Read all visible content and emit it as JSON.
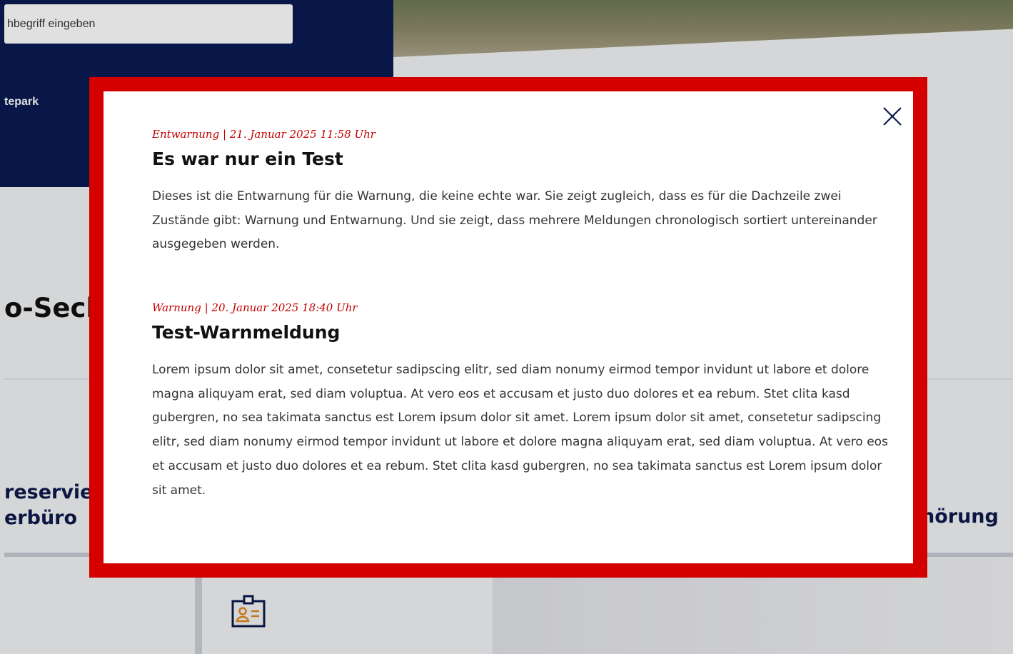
{
  "background": {
    "search": {
      "placeholder": "hbegriff eingeben"
    },
    "nav_link": "tepark",
    "section_heading": "o-Sech",
    "tile_left_line1": "reservie",
    "tile_left_line2": "erbüro",
    "tile_right": "hörung",
    "badge_icon": "id-badge-icon"
  },
  "modal": {
    "close_icon": "close-icon",
    "accent_color": "#d40000",
    "alerts": [
      {
        "meta": "Entwarnung | 21. Januar 2025 11:58 Uhr",
        "title": "Es war nur ein Test",
        "body": "Dieses ist die Entwarnung für die Warnung, die keine echte war. Sie zeigt zugleich, dass es für die Dachzeile zwei Zustände gibt: Warnung und Entwarnung. Und sie zeigt, dass mehrere Meldungen chronologisch sortiert untereinander ausgegeben werden."
      },
      {
        "meta": "Warnung | 20. Januar 2025 18:40 Uhr",
        "title": "Test-Warnmeldung",
        "body": "Lorem ipsum dolor sit amet, consetetur sadipscing elitr, sed diam nonumy eirmod tempor invidunt ut labore et dolore magna aliquyam erat, sed diam voluptua. At vero eos et accusam et justo duo dolores et ea rebum. Stet clita kasd gubergren, no sea takimata sanctus est Lorem ipsum dolor sit amet. Lorem ipsum dolor sit amet, consetetur sadipscing elitr, sed diam nonumy eirmod tempor invidunt ut labore et dolore magna aliquyam erat, sed diam voluptua. At vero eos et accusam et justo duo dolores et ea rebum. Stet clita kasd gubergren, no sea takimata sanctus est Lorem ipsum dolor sit amet."
      }
    ]
  }
}
